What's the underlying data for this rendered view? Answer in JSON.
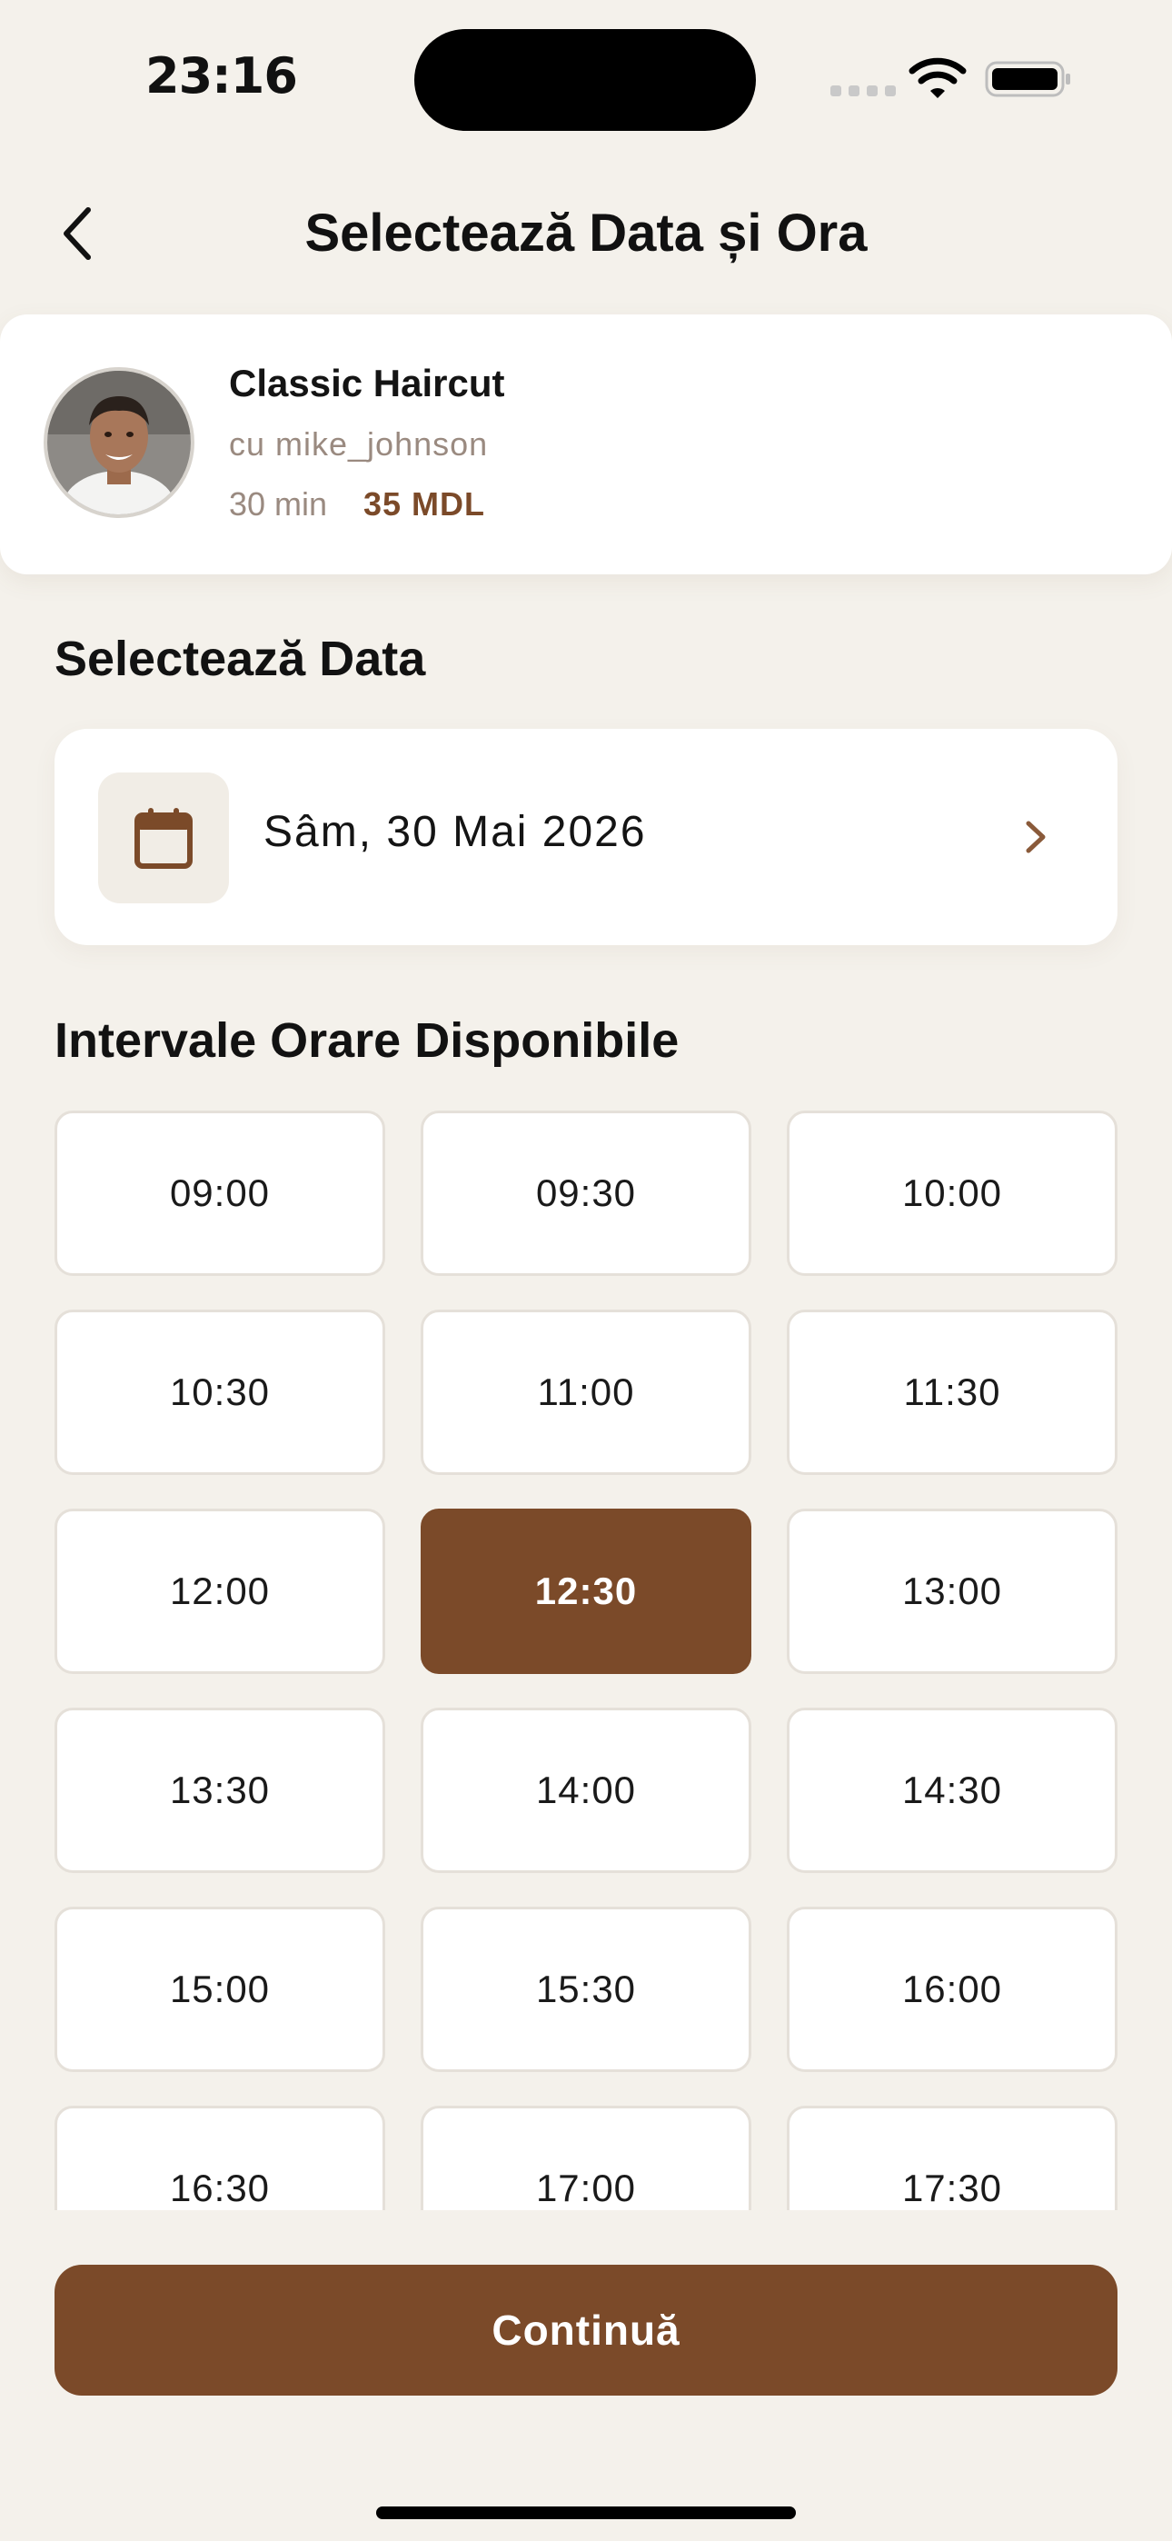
{
  "status_bar": {
    "time": "23:16"
  },
  "header": {
    "title": "Selectează Data și Ora",
    "back_icon": "chevron-left-icon"
  },
  "service_card": {
    "service_name": "Classic Haircut",
    "barber": "cu mike_johnson",
    "duration": "30 min",
    "price": "35 MDL"
  },
  "date_section": {
    "heading": "Selectează Data",
    "selected_date": "Sâm, 30 Mai 2026",
    "icon": "calendar-icon"
  },
  "slots_section": {
    "heading": "Intervale Orare Disponibile",
    "slots": [
      "09:00",
      "09:30",
      "10:00",
      "10:30",
      "11:00",
      "11:30",
      "12:00",
      "12:30",
      "13:00",
      "13:30",
      "14:00",
      "14:30",
      "15:00",
      "15:30",
      "16:00",
      "16:30",
      "17:00",
      "17:30"
    ],
    "selected_index": 7
  },
  "footer": {
    "continue_label": "Continuă"
  },
  "colors": {
    "background": "#f4f1eb",
    "accent": "#7b4a29",
    "card": "#ffffff",
    "muted_text": "#9a8a80"
  }
}
